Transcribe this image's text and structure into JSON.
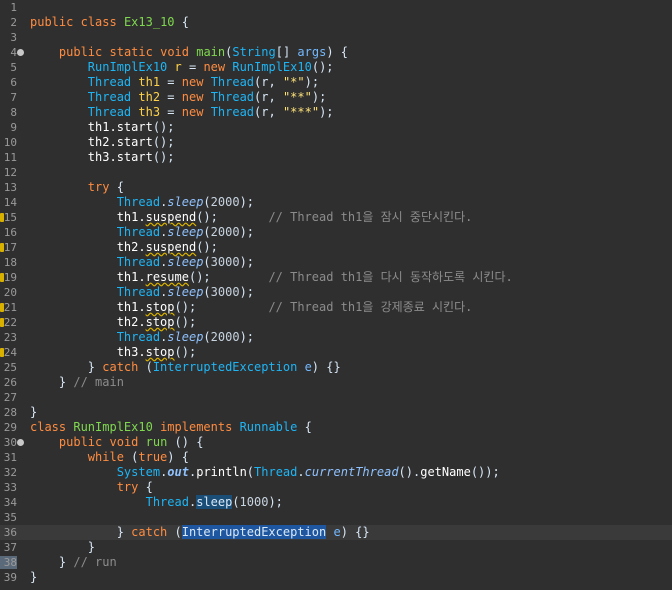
{
  "editor": {
    "lines": [
      {
        "n": "1",
        "tokens": []
      },
      {
        "n": "2",
        "tokens": [
          [
            "kw",
            "public"
          ],
          [
            "t",
            " "
          ],
          [
            "kw",
            "class"
          ],
          [
            "t",
            " "
          ],
          [
            "decl",
            "Ex13_10"
          ],
          [
            "t",
            " {"
          ]
        ]
      },
      {
        "n": "3",
        "tokens": []
      },
      {
        "n": "4",
        "fold": true,
        "tokens": [
          [
            "t",
            "    "
          ],
          [
            "kw",
            "public"
          ],
          [
            "t",
            " "
          ],
          [
            "kw",
            "static"
          ],
          [
            "t",
            " "
          ],
          [
            "kw",
            "void"
          ],
          [
            "t",
            " "
          ],
          [
            "decl",
            "main"
          ],
          [
            "t",
            "("
          ],
          [
            "type",
            "String"
          ],
          [
            "t",
            "[] "
          ],
          [
            "param",
            "args"
          ],
          [
            "t",
            ") {"
          ]
        ]
      },
      {
        "n": "5",
        "tokens": [
          [
            "t",
            "        "
          ],
          [
            "type",
            "RunImplEx10"
          ],
          [
            "t",
            " "
          ],
          [
            "var",
            "r"
          ],
          [
            "t",
            " = "
          ],
          [
            "kw",
            "new"
          ],
          [
            "t",
            " "
          ],
          [
            "type",
            "RunImplEx10"
          ],
          [
            "t",
            "();"
          ]
        ]
      },
      {
        "n": "6",
        "tokens": [
          [
            "t",
            "        "
          ],
          [
            "type",
            "Thread"
          ],
          [
            "t",
            " "
          ],
          [
            "var",
            "th1"
          ],
          [
            "t",
            " = "
          ],
          [
            "kw",
            "new"
          ],
          [
            "t",
            " "
          ],
          [
            "type",
            "Thread"
          ],
          [
            "t",
            "(r, "
          ],
          [
            "str",
            "\"*\""
          ],
          [
            "t",
            ");"
          ]
        ]
      },
      {
        "n": "7",
        "tokens": [
          [
            "t",
            "        "
          ],
          [
            "type",
            "Thread"
          ],
          [
            "t",
            " "
          ],
          [
            "var",
            "th2"
          ],
          [
            "t",
            " = "
          ],
          [
            "kw",
            "new"
          ],
          [
            "t",
            " "
          ],
          [
            "type",
            "Thread"
          ],
          [
            "t",
            "(r, "
          ],
          [
            "str",
            "\"**\""
          ],
          [
            "t",
            ");"
          ]
        ]
      },
      {
        "n": "8",
        "tokens": [
          [
            "t",
            "        "
          ],
          [
            "type",
            "Thread"
          ],
          [
            "t",
            " "
          ],
          [
            "var",
            "th3"
          ],
          [
            "t",
            " = "
          ],
          [
            "kw",
            "new"
          ],
          [
            "t",
            " "
          ],
          [
            "type",
            "Thread"
          ],
          [
            "t",
            "(r, "
          ],
          [
            "str",
            "\"***\""
          ],
          [
            "t",
            ");"
          ]
        ]
      },
      {
        "n": "9",
        "tokens": [
          [
            "t",
            "        "
          ],
          [
            "meth",
            "th1.start"
          ],
          [
            "t",
            "();"
          ]
        ]
      },
      {
        "n": "10",
        "tokens": [
          [
            "t",
            "        "
          ],
          [
            "meth",
            "th2.start"
          ],
          [
            "t",
            "();"
          ]
        ]
      },
      {
        "n": "11",
        "tokens": [
          [
            "t",
            "        "
          ],
          [
            "meth",
            "th3.start"
          ],
          [
            "t",
            "();"
          ]
        ]
      },
      {
        "n": "12",
        "tokens": []
      },
      {
        "n": "13",
        "tokens": [
          [
            "t",
            "        "
          ],
          [
            "kw",
            "try"
          ],
          [
            "t",
            " {"
          ]
        ]
      },
      {
        "n": "14",
        "tokens": [
          [
            "t",
            "            "
          ],
          [
            "type",
            "Thread"
          ],
          [
            "t",
            "."
          ],
          [
            "sm",
            "sleep"
          ],
          [
            "t",
            "("
          ],
          [
            "num",
            "2000"
          ],
          [
            "t",
            ");"
          ]
        ]
      },
      {
        "n": "15",
        "marker": true,
        "tokens": [
          [
            "t",
            "            "
          ],
          [
            "meth",
            "th1."
          ],
          [
            "dep",
            "suspend"
          ],
          [
            "t",
            "();       "
          ],
          [
            "cmt",
            "// Thread th1을 잠시 중단시킨다."
          ]
        ]
      },
      {
        "n": "16",
        "tokens": [
          [
            "t",
            "            "
          ],
          [
            "type",
            "Thread"
          ],
          [
            "t",
            "."
          ],
          [
            "sm",
            "sleep"
          ],
          [
            "t",
            "("
          ],
          [
            "num",
            "2000"
          ],
          [
            "t",
            ");"
          ]
        ]
      },
      {
        "n": "17",
        "marker": true,
        "tokens": [
          [
            "t",
            "            "
          ],
          [
            "meth",
            "th2."
          ],
          [
            "dep",
            "suspend"
          ],
          [
            "t",
            "();"
          ]
        ]
      },
      {
        "n": "18",
        "tokens": [
          [
            "t",
            "            "
          ],
          [
            "type",
            "Thread"
          ],
          [
            "t",
            "."
          ],
          [
            "sm",
            "sleep"
          ],
          [
            "t",
            "("
          ],
          [
            "num",
            "3000"
          ],
          [
            "t",
            ");"
          ]
        ]
      },
      {
        "n": "19",
        "marker": true,
        "tokens": [
          [
            "t",
            "            "
          ],
          [
            "meth",
            "th1."
          ],
          [
            "dep",
            "resume"
          ],
          [
            "t",
            "();        "
          ],
          [
            "cmt",
            "// Thread th1을 다시 동작하도록 시킨다."
          ]
        ]
      },
      {
        "n": "20",
        "tokens": [
          [
            "t",
            "            "
          ],
          [
            "type",
            "Thread"
          ],
          [
            "t",
            "."
          ],
          [
            "sm",
            "sleep"
          ],
          [
            "t",
            "("
          ],
          [
            "num",
            "3000"
          ],
          [
            "t",
            ");"
          ]
        ]
      },
      {
        "n": "21",
        "marker": true,
        "tokens": [
          [
            "t",
            "            "
          ],
          [
            "meth",
            "th1."
          ],
          [
            "dep",
            "stop"
          ],
          [
            "t",
            "();          "
          ],
          [
            "cmt",
            "// Thread th1을 강제종료 시킨다."
          ]
        ]
      },
      {
        "n": "22",
        "marker": true,
        "tokens": [
          [
            "t",
            "            "
          ],
          [
            "meth",
            "th2."
          ],
          [
            "dep",
            "stop"
          ],
          [
            "t",
            "();"
          ]
        ]
      },
      {
        "n": "23",
        "tokens": [
          [
            "t",
            "            "
          ],
          [
            "type",
            "Thread"
          ],
          [
            "t",
            "."
          ],
          [
            "sm",
            "sleep"
          ],
          [
            "t",
            "("
          ],
          [
            "num",
            "2000"
          ],
          [
            "t",
            ");"
          ]
        ]
      },
      {
        "n": "24",
        "marker": true,
        "tokens": [
          [
            "t",
            "            "
          ],
          [
            "meth",
            "th3."
          ],
          [
            "dep",
            "stop"
          ],
          [
            "t",
            "();"
          ]
        ]
      },
      {
        "n": "25",
        "tokens": [
          [
            "t",
            "        } "
          ],
          [
            "kw",
            "catch"
          ],
          [
            "t",
            " ("
          ],
          [
            "type",
            "InterruptedException"
          ],
          [
            "t",
            " "
          ],
          [
            "param",
            "e"
          ],
          [
            "t",
            ") {}"
          ]
        ]
      },
      {
        "n": "26",
        "tokens": [
          [
            "t",
            "    } "
          ],
          [
            "cmt",
            "// main"
          ]
        ]
      },
      {
        "n": "27",
        "tokens": []
      },
      {
        "n": "28",
        "tokens": [
          [
            "t",
            "}"
          ]
        ]
      },
      {
        "n": "29",
        "tokens": [
          [
            "kw",
            "class"
          ],
          [
            "t",
            " "
          ],
          [
            "decl",
            "RunImplEx10"
          ],
          [
            "t",
            " "
          ],
          [
            "kw",
            "implements"
          ],
          [
            "t",
            " "
          ],
          [
            "type",
            "Runnable"
          ],
          [
            "t",
            " {"
          ]
        ]
      },
      {
        "n": "30",
        "fold": true,
        "tokens": [
          [
            "t",
            "    "
          ],
          [
            "kw",
            "public"
          ],
          [
            "t",
            " "
          ],
          [
            "kw",
            "void"
          ],
          [
            "t",
            " "
          ],
          [
            "decl",
            "run"
          ],
          [
            "t",
            " () {"
          ]
        ]
      },
      {
        "n": "31",
        "tokens": [
          [
            "t",
            "        "
          ],
          [
            "kw",
            "while"
          ],
          [
            "t",
            " ("
          ],
          [
            "kw",
            "true"
          ],
          [
            "t",
            ") {"
          ]
        ]
      },
      {
        "n": "32",
        "tokens": [
          [
            "t",
            "            "
          ],
          [
            "type",
            "System"
          ],
          [
            "t",
            "."
          ],
          [
            "field",
            "out"
          ],
          [
            "t",
            "."
          ],
          [
            "meth",
            "println"
          ],
          [
            "t",
            "("
          ],
          [
            "type",
            "Thread"
          ],
          [
            "t",
            "."
          ],
          [
            "sm",
            "currentThread"
          ],
          [
            "t",
            "()."
          ],
          [
            "meth",
            "getName"
          ],
          [
            "t",
            "());"
          ]
        ]
      },
      {
        "n": "33",
        "tokens": [
          [
            "t",
            "            "
          ],
          [
            "kw",
            "try"
          ],
          [
            "t",
            " {"
          ]
        ]
      },
      {
        "n": "34",
        "tokens": [
          [
            "t",
            "                "
          ],
          [
            "type",
            "Thread"
          ],
          [
            "t",
            "."
          ],
          [
            "occ",
            "sleep"
          ],
          [
            "t",
            "("
          ],
          [
            "num",
            "1000"
          ],
          [
            "t",
            ");"
          ]
        ]
      },
      {
        "n": "35",
        "tokens": []
      },
      {
        "n": "36",
        "current": true,
        "tokens": [
          [
            "t",
            "            } "
          ],
          [
            "kw",
            "catch"
          ],
          [
            "t",
            " ("
          ],
          [
            "sel",
            "InterruptedException"
          ],
          [
            "t",
            " "
          ],
          [
            "param",
            "e"
          ],
          [
            "t",
            ") {}"
          ]
        ]
      },
      {
        "n": "37",
        "tokens": [
          [
            "t",
            "        }"
          ]
        ]
      },
      {
        "n": "38",
        "bookmark": true,
        "tokens": [
          [
            "t",
            "    } "
          ],
          [
            "cmt",
            "// run"
          ]
        ]
      },
      {
        "n": "39",
        "tokens": [
          [
            "t",
            "}"
          ]
        ]
      }
    ]
  }
}
